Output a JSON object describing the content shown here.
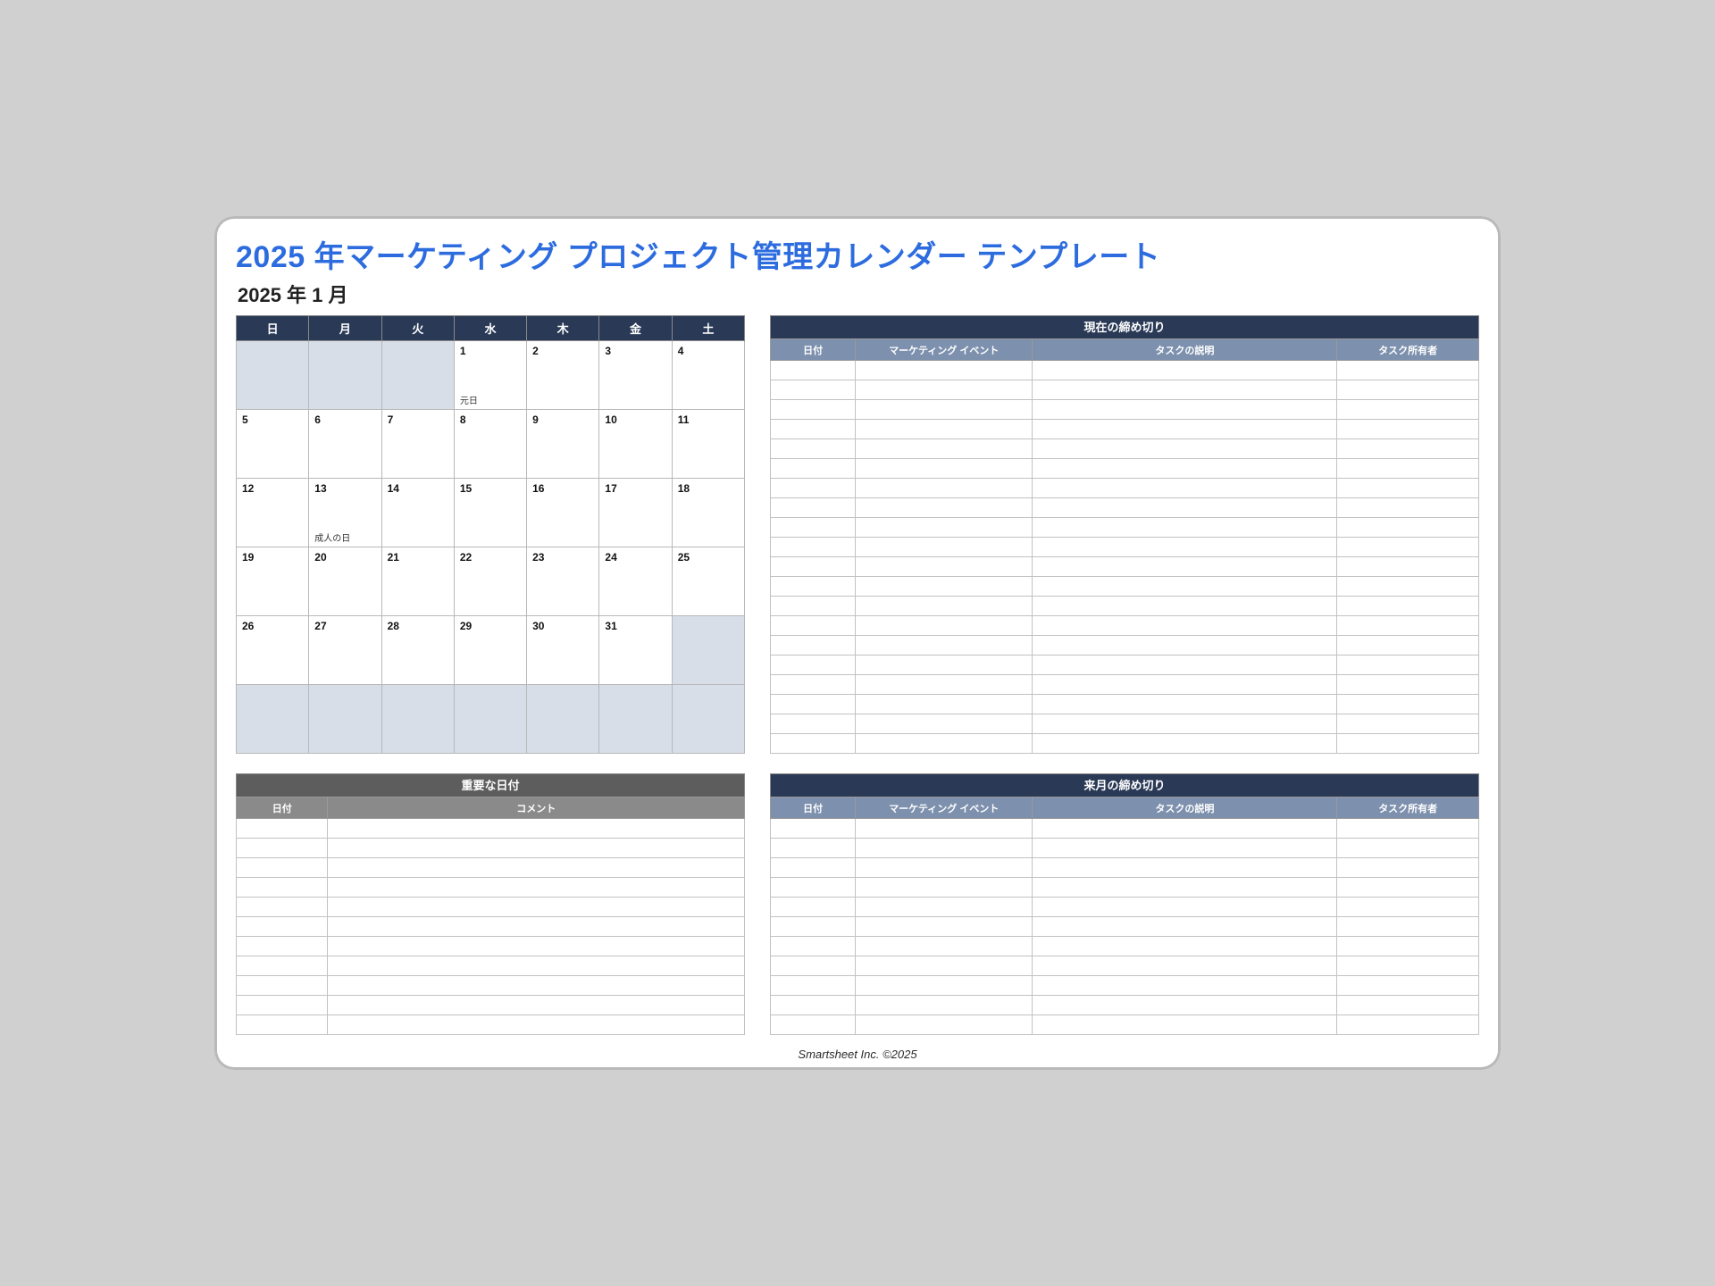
{
  "title": "2025 年マーケティング プロジェクト管理カレンダー テンプレート",
  "subtitle": "2025 年 1 月",
  "weekdays": [
    "日",
    "月",
    "火",
    "水",
    "木",
    "金",
    "土"
  ],
  "calendar_rows": [
    [
      {
        "blank": true
      },
      {
        "blank": true
      },
      {
        "blank": true
      },
      {
        "day": "1",
        "holiday": "元日"
      },
      {
        "day": "2"
      },
      {
        "day": "3"
      },
      {
        "day": "4"
      }
    ],
    [
      {
        "day": "5"
      },
      {
        "day": "6"
      },
      {
        "day": "7"
      },
      {
        "day": "8"
      },
      {
        "day": "9"
      },
      {
        "day": "10"
      },
      {
        "day": "11"
      }
    ],
    [
      {
        "day": "12"
      },
      {
        "day": "13",
        "holiday": "成人の日"
      },
      {
        "day": "14"
      },
      {
        "day": "15"
      },
      {
        "day": "16"
      },
      {
        "day": "17"
      },
      {
        "day": "18"
      }
    ],
    [
      {
        "day": "19"
      },
      {
        "day": "20"
      },
      {
        "day": "21"
      },
      {
        "day": "22"
      },
      {
        "day": "23"
      },
      {
        "day": "24"
      },
      {
        "day": "25"
      }
    ],
    [
      {
        "day": "26"
      },
      {
        "day": "27"
      },
      {
        "day": "28"
      },
      {
        "day": "29"
      },
      {
        "day": "30"
      },
      {
        "day": "31"
      },
      {
        "blank": true
      }
    ],
    [
      {
        "blank": true
      },
      {
        "blank": true
      },
      {
        "blank": true
      },
      {
        "blank": true
      },
      {
        "blank": true
      },
      {
        "blank": true
      },
      {
        "blank": true
      }
    ]
  ],
  "current_deadlines": {
    "title": "現在の締め切り",
    "columns": [
      "日付",
      "マーケティング イベント",
      "タスクの説明",
      "タスク所有者"
    ],
    "col_widths": [
      "12%",
      "25%",
      "43%",
      "20%"
    ],
    "row_count": 20
  },
  "important_dates": {
    "title": "重要な日付",
    "columns": [
      "日付",
      "コメント"
    ],
    "col_widths": [
      "18%",
      "82%"
    ],
    "row_count": 11
  },
  "next_deadlines": {
    "title": "来月の締め切り",
    "columns": [
      "日付",
      "マーケティング イベント",
      "タスクの説明",
      "タスク所有者"
    ],
    "col_widths": [
      "12%",
      "25%",
      "43%",
      "20%"
    ],
    "row_count": 11
  },
  "footer": "Smartsheet Inc. ©2025"
}
